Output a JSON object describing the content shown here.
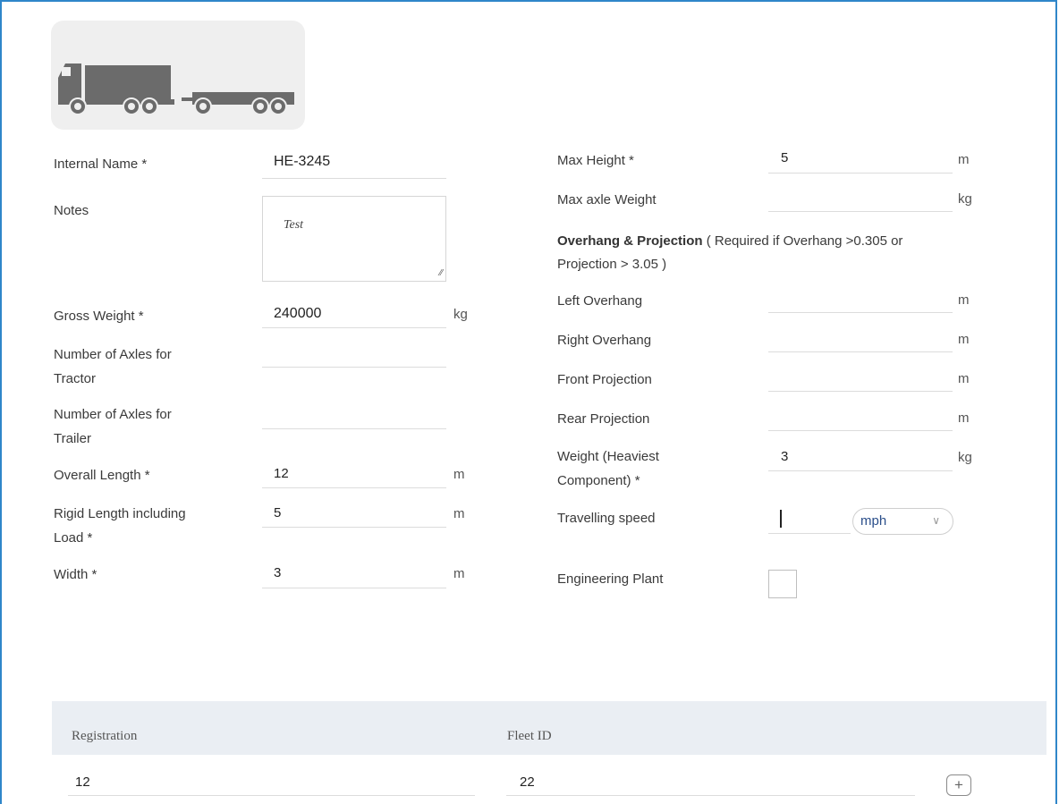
{
  "vehicle": {
    "icon": "truck-with-trailer-icon"
  },
  "left": {
    "internal_name": {
      "label": "Internal Name *",
      "value": "HE-3245"
    },
    "notes": {
      "label": "Notes",
      "value": "Test"
    },
    "gross_weight": {
      "label": "Gross Weight *",
      "value": "240000",
      "unit": "kg"
    },
    "axles_tractor": {
      "label_1": "Number of Axles for",
      "label_2": "Tractor",
      "value": ""
    },
    "axles_trailer": {
      "label_1": "Number of Axles for",
      "label_2": "Trailer",
      "value": ""
    },
    "overall_length": {
      "label": "Overall Length *",
      "value": "12",
      "unit": "m"
    },
    "rigid_length": {
      "label_1": "Rigid Length including",
      "label_2": "Load *",
      "value": "5",
      "unit": "m"
    },
    "width": {
      "label": "Width *",
      "value": "3",
      "unit": "m"
    }
  },
  "right": {
    "max_height": {
      "label": "Max Height *",
      "value": "5",
      "unit": "m"
    },
    "max_axle_weight": {
      "label": "Max axle Weight",
      "value": "",
      "unit": "kg"
    },
    "overhang_heading": {
      "bold": "Overhang & Projection",
      "line_1_rest": " ( Required if Overhang >0.305 or",
      "line_2": "Projection > 3.05 )"
    },
    "left_overhang": {
      "label": "Left Overhang",
      "value": "",
      "unit": "m"
    },
    "right_overhang": {
      "label": "Right Overhang",
      "value": "",
      "unit": "m"
    },
    "front_projection": {
      "label": "Front Projection",
      "value": "",
      "unit": "m"
    },
    "rear_projection": {
      "label": "Rear Projection",
      "value": "",
      "unit": "m"
    },
    "heaviest_component": {
      "label_1": "Weight (Heaviest",
      "label_2": "Component) *",
      "value": "3",
      "unit": "kg"
    },
    "travelling_speed": {
      "label": "Travelling speed",
      "value": "",
      "unit_selected": "mph"
    },
    "engineering_plant": {
      "label": "Engineering Plant",
      "checked": false
    }
  },
  "table": {
    "headers": [
      "Registration",
      "Fleet ID"
    ],
    "rows": [
      {
        "registration": "12",
        "fleet_id": "22"
      }
    ],
    "add_label": "+"
  }
}
